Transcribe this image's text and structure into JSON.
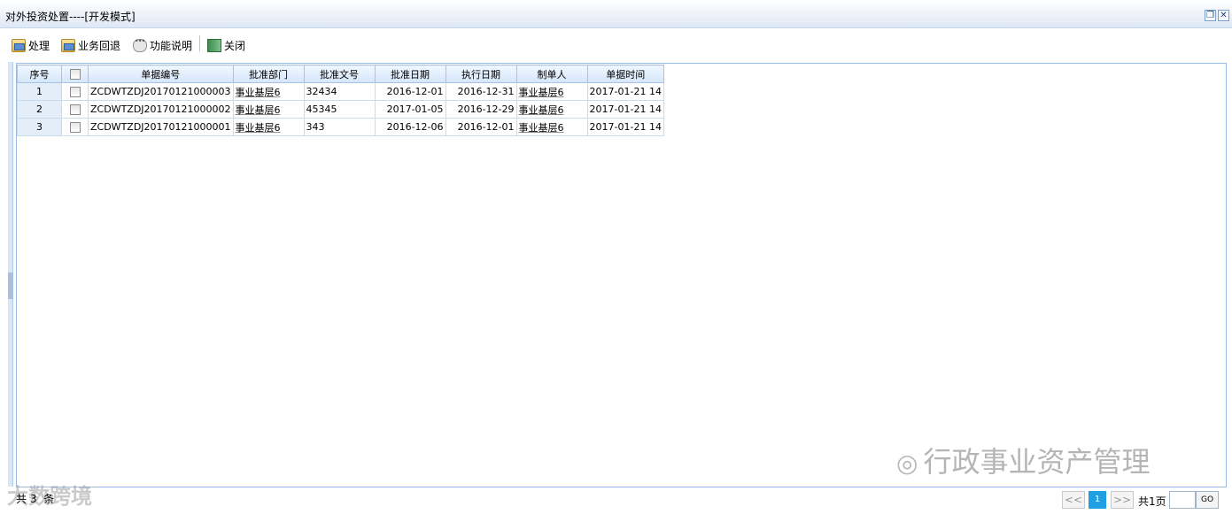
{
  "window": {
    "title": "对外投资处置----[开发模式]",
    "restore_icon": "restore-icon",
    "close_icon": "close-icon"
  },
  "toolbar": {
    "buttons": [
      {
        "label": "处理",
        "icon": "database-icon"
      },
      {
        "label": "业务回退",
        "icon": "database-icon"
      },
      {
        "label": "功能说明",
        "icon": "speech-bubble-icon"
      },
      {
        "label": "关闭",
        "icon": "exit-door-icon"
      }
    ]
  },
  "grid": {
    "columns": [
      "序号",
      "",
      "单据编号",
      "批准部门",
      "批准文号",
      "批准日期",
      "执行日期",
      "制单人",
      "单据时间"
    ],
    "rows": [
      {
        "index": "1",
        "checked": false,
        "doc_no": "ZCDWTZDJ20170121000003",
        "dept": "事业基层6",
        "approval_no": "32434",
        "approval_date": "2016-12-01",
        "exec_date": "2016-12-31",
        "creator": "事业基层6",
        "doc_time": "2017-01-21 14"
      },
      {
        "index": "2",
        "checked": false,
        "doc_no": "ZCDWTZDJ20170121000002",
        "dept": "事业基层6",
        "approval_no": "45345",
        "approval_date": "2017-01-05",
        "exec_date": "2016-12-29",
        "creator": "事业基层6",
        "doc_time": "2017-01-21 14"
      },
      {
        "index": "3",
        "checked": false,
        "doc_no": "ZCDWTZDJ20170121000001",
        "dept": "事业基层6",
        "approval_no": "343",
        "approval_date": "2016-12-06",
        "exec_date": "2016-12-01",
        "creator": "事业基层6",
        "doc_time": "2017-01-21 14"
      }
    ]
  },
  "status": {
    "text": "共 3  条"
  },
  "pager": {
    "prev_label": "<<",
    "current_page": "1",
    "next_label": ">>",
    "total_label": "共1页",
    "go_label": "GO"
  },
  "watermarks": {
    "right": "行政事业资产管理",
    "left": "大数跨境"
  },
  "colors": {
    "header_bg": "#d5e6fa",
    "border": "#99bbe8",
    "pager_current": "#1ea0e2"
  }
}
